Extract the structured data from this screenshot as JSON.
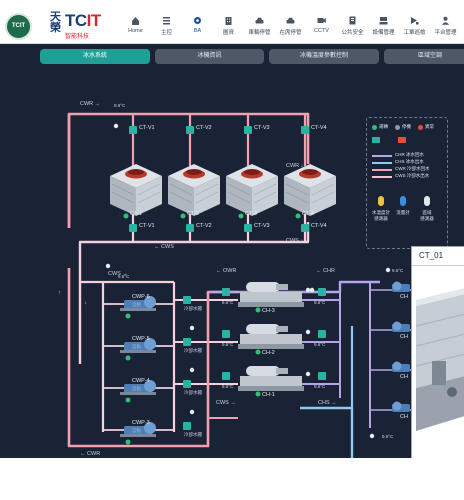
{
  "header": {
    "seal_text": "TCIT",
    "brand_cn": "天榮",
    "brand_en_main": "TC",
    "brand_en_accent": "IT",
    "brand_sub": "智能科技",
    "nav": [
      {
        "label": "Home",
        "icon": "home-icon",
        "active": false
      },
      {
        "label": "主控",
        "icon": "list-icon",
        "active": false
      },
      {
        "label": "BA",
        "icon": "gear-icon",
        "active": true
      },
      {
        "label": "圖資",
        "icon": "building-icon",
        "active": false
      },
      {
        "label": "車輛停管",
        "icon": "car-icon",
        "active": false
      },
      {
        "label": "在席停管",
        "icon": "parking-icon",
        "active": false
      },
      {
        "label": "CCTV",
        "icon": "camera-icon",
        "active": false
      },
      {
        "label": "公共安全",
        "icon": "shield-icon",
        "active": false
      },
      {
        "label": "設備管理",
        "icon": "device-icon",
        "active": false
      },
      {
        "label": "工單巡檢",
        "icon": "clipboard-icon",
        "active": false
      },
      {
        "label": "平台管理",
        "icon": "user-gear-icon",
        "active": false
      }
    ]
  },
  "tabs": [
    {
      "label": "冰水系統",
      "active": true
    },
    {
      "label": "冰機資訊",
      "active": false
    },
    {
      "label": "冰機溫度參數控制",
      "active": false
    },
    {
      "label": "區域空調",
      "active": false
    }
  ],
  "diagram": {
    "cwr_top": "CWR →",
    "cwr_right": "CWR ↓",
    "cws_mid": "← CWS",
    "cws_right": "CWS ↓",
    "cws_pumps": "CWS →",
    "cwr_bottom": "← CWR",
    "owr_label": "← OWR",
    "chr_label": "← CHR",
    "cws_lower": "CWS →",
    "chs_label": "CHS →",
    "temp_reading": "9.6°C",
    "towers": [
      "CT-1",
      "CT-2",
      "CT-3",
      "CT-4"
    ],
    "top_valves": [
      "CT-V1",
      "CT-V2",
      "CT-V3",
      "CT-V4"
    ],
    "bottom_valves": [
      "CT-V1",
      "CT-V2",
      "CT-V3",
      "CT-V4"
    ],
    "pumps": [
      {
        "name": "CWP-6",
        "status": "自動"
      },
      {
        "name": "CWP-5",
        "status": "自動"
      },
      {
        "name": "CWP-4",
        "status": "自動"
      },
      {
        "name": "CWP-3",
        "status": "自動"
      }
    ],
    "pump_valve_label": "冷卻水閥",
    "chillers": [
      "CH-3",
      "CH-2",
      "CH-1"
    ],
    "right_pump_prefix": "CH",
    "arrow_left": "↑",
    "arrow_down": "↓"
  },
  "legend": {
    "status": [
      "運轉",
      "停機",
      "異常"
    ],
    "lines": [
      {
        "label": "CHR 冰水回水",
        "color": "#b6a4e8"
      },
      {
        "label": "CHS 冰水出水",
        "color": "#8ec9f0"
      },
      {
        "label": "CWR 冷卻水回水",
        "color": "#f2a0b0"
      },
      {
        "label": "CWS 冷卻水出水",
        "color": "#f2c7d3"
      }
    ],
    "sensors": [
      "水溫度計\n感測器",
      "流量計",
      "區域\n感測器"
    ],
    "status_colors": {
      "run": "#2fbf71",
      "stop": "#8e9aa8",
      "fault": "#e74c3c"
    }
  },
  "popup": {
    "title": "CT_01"
  },
  "colors": {
    "background": "#1a2236",
    "cwr_pipe": "#f2a0b0",
    "cws_pipe": "#f4d1dc",
    "chr_pipe": "#b6a4e8",
    "chs_pipe": "#8ec9f0",
    "accent": "#1f9f95"
  }
}
